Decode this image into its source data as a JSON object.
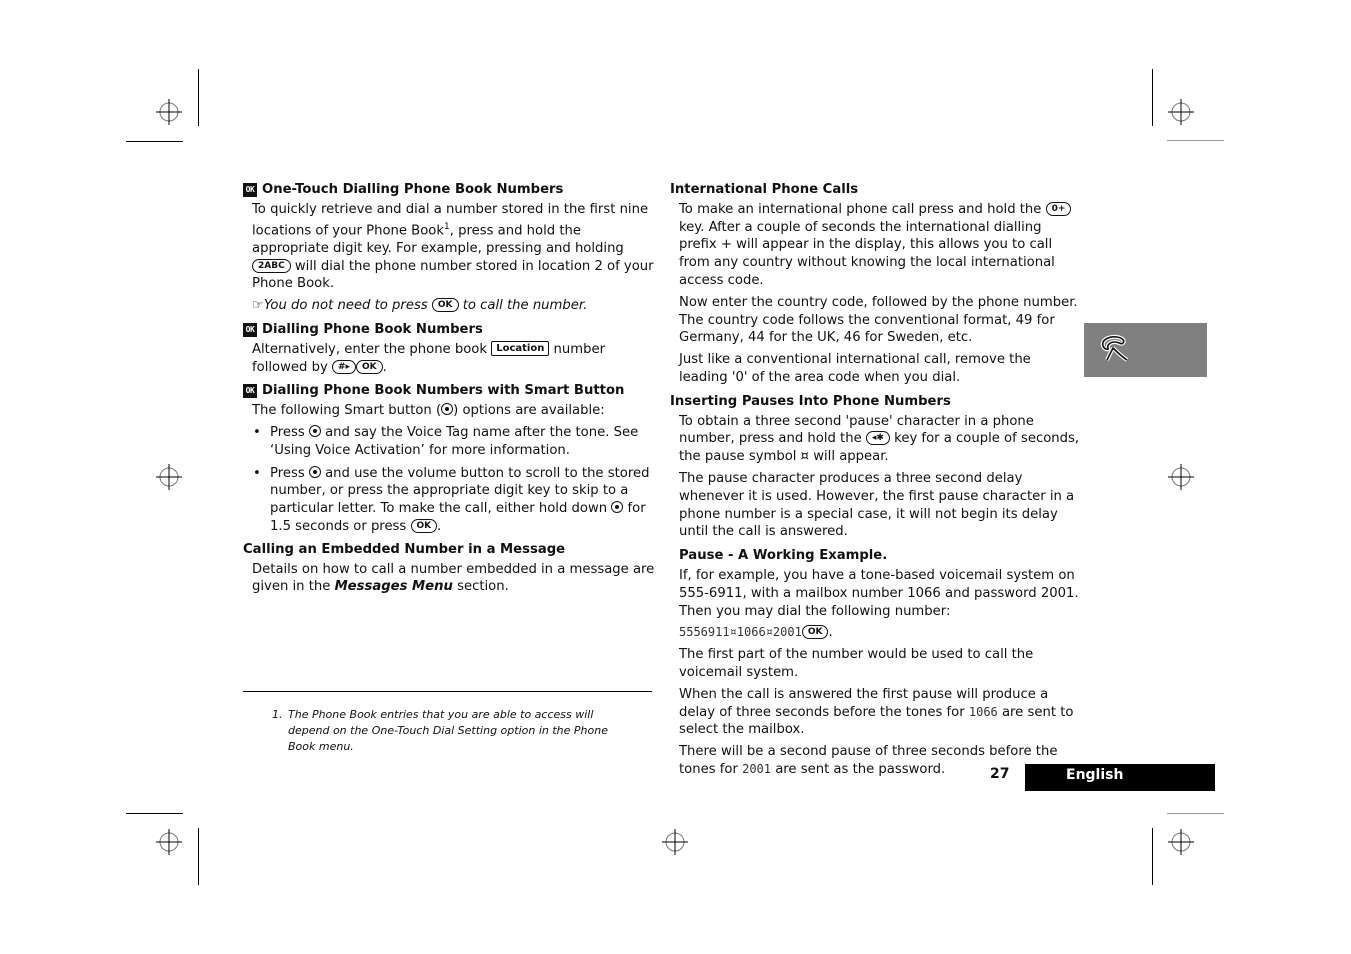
{
  "left_column": {
    "sections": [
      {
        "heading": "One-Touch Dialling Phone Book Numbers",
        "icon": "ok-icon",
        "para_parts": [
          "To quickly retrieve and dial a number stored in the first nine locations of your Phone Book",
          "1",
          ", press and hold the appropriate digit key. For example, pressing and holding ",
          " will dial the phone number stored in location 2 of your Phone Book."
        ],
        "key_label": "2ABC",
        "note_parts": [
          "You do not need to press ",
          " to call the number."
        ],
        "note_key": "OK"
      },
      {
        "heading": "Dialling Phone Book Numbers",
        "icon": "ok-icon",
        "para_parts": [
          "Alternatively, enter the phone book ",
          " number followed by ",
          "."
        ],
        "location_key": "Location",
        "hash_key": "#▸",
        "ok_key": "OK"
      },
      {
        "heading": "Dialling Phone Book Numbers with Smart Button",
        "icon": "ok-icon",
        "intro_parts": [
          "The following Smart button (",
          ") options are available:"
        ],
        "bullets": [
          {
            "parts": [
              "Press ",
              " and say the Voice Tag name after the tone. See ‘Using Voice Activation’ for more information."
            ]
          },
          {
            "parts": [
              "Press ",
              " and use the volume button to scroll to the stored number, or press the appropriate digit key to skip to a particular letter. To make the call, either hold down ",
              " for 1.5 seconds or press ",
              "."
            ],
            "ok_key": "OK"
          }
        ]
      },
      {
        "heading": "Calling an Embedded Number in a Message",
        "para_parts": [
          "Details on how to call a number embedded in a message are given in the ",
          "Messages Menu",
          " section."
        ]
      }
    ],
    "footnote": {
      "number": "1.",
      "text": "The Phone Book entries that you are able to access will depend on the One-Touch Dial Setting option in the Phone Book menu."
    }
  },
  "right_column": {
    "international": {
      "heading": "International Phone Calls",
      "p1_parts": [
        "To make an international phone call press and hold the ",
        " key. After a couple of seconds the international dialling prefix + will appear in the display, this allows you to call from any country without knowing the local international access code."
      ],
      "zero_key": "0+",
      "p2": "Now enter the country code, followed by the phone number. The country code follows the conventional format, 49 for Germany, 44 for the UK, 46 for Sweden, etc.",
      "p3": "Just like a conventional international call, remove the leading '0' of the area code when you dial."
    },
    "pauses": {
      "heading": "Inserting Pauses Into Phone Numbers",
      "p1_parts": [
        "To obtain a three second 'pause' character in a phone number, press and hold the ",
        " key for a couple of seconds, the pause symbol ¤ will appear."
      ],
      "star_key": "◂✱",
      "p2": "The pause character produces a three second delay whenever it is used. However, the first pause character in a phone number is a special case, it will not begin its delay until the call is answered."
    },
    "example": {
      "heading": "Pause - A Working Example.",
      "p1": "If, for example, you have a tone-based voicemail system on 555-6911, with a mailbox number 1066 and password 2001. Then you may dial the following number:",
      "number": "5556911¤1066¤2001",
      "ok_key": "OK",
      "p2": "The first part of the number would be used to call the voicemail system.",
      "p3_parts": [
        "When the call is answered the first pause will produce a delay of three seconds before the tones for ",
        "1066",
        " are sent to select the mailbox."
      ],
      "p4_parts": [
        "There will be a second pause of three seconds before the tones for ",
        "2001",
        " are sent as the password."
      ]
    }
  },
  "side_tab": {
    "icon": "phone-handset-icon",
    "color": "#808080"
  },
  "footer": {
    "page_number": "27",
    "language": "English"
  }
}
